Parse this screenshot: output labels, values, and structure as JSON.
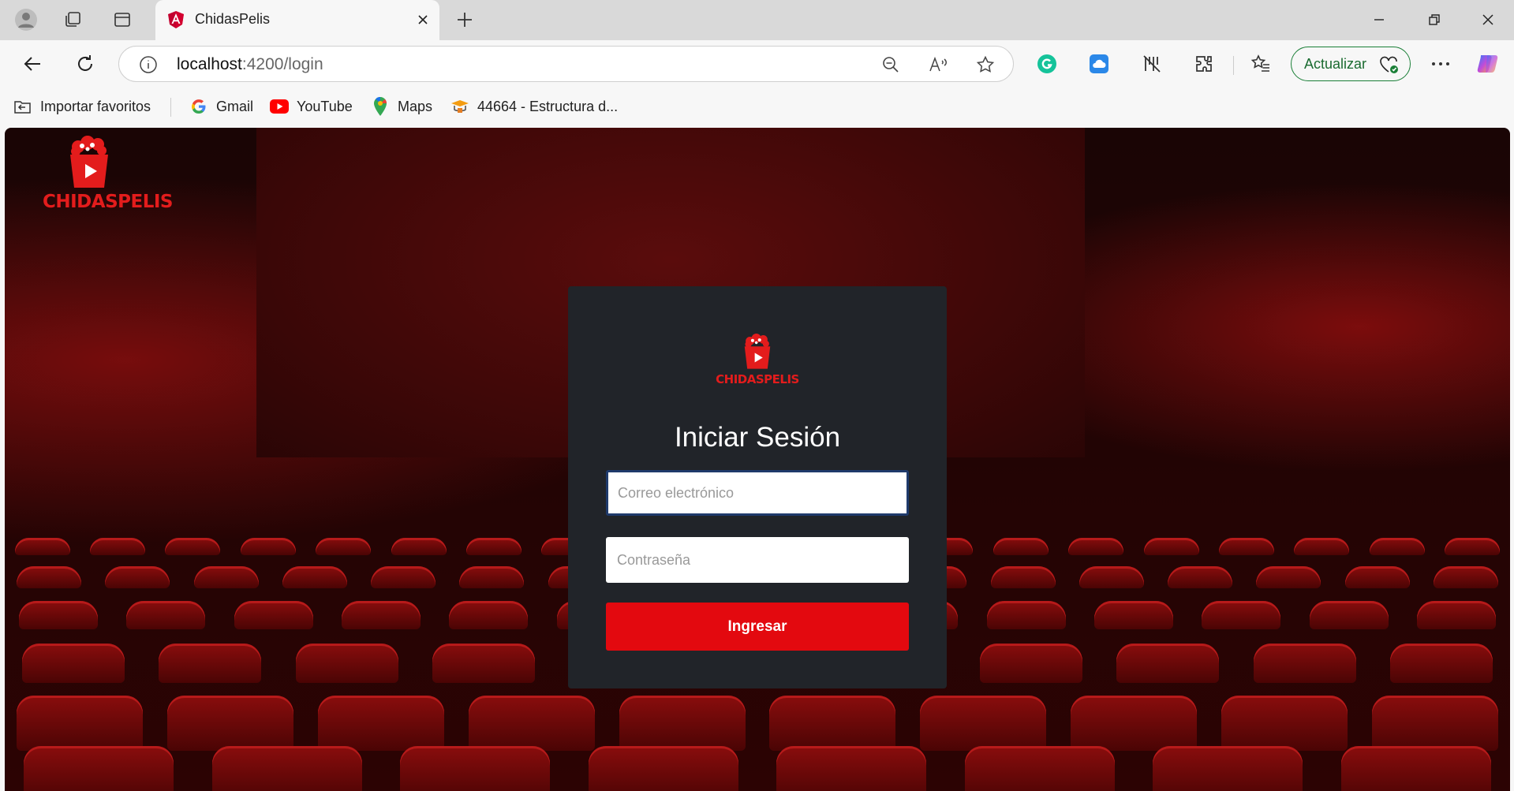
{
  "browser": {
    "tab": {
      "title": "ChidasPelis"
    },
    "address": {
      "host": "localhost",
      "path": ":4200/login"
    },
    "update_label": "Actualizar",
    "bookmarks": [
      {
        "label": "Importar favoritos",
        "icon": "import-icon"
      },
      {
        "label": "Gmail",
        "icon": "google-icon"
      },
      {
        "label": "YouTube",
        "icon": "youtube-icon"
      },
      {
        "label": "Maps",
        "icon": "maps-icon"
      },
      {
        "label": "44664 - Estructura d...",
        "icon": "course-icon"
      }
    ]
  },
  "page": {
    "brand": "CHIDASPELIS",
    "login": {
      "title": "Iniciar Sesión",
      "email_placeholder": "Correo electrónico",
      "password_placeholder": "Contraseña",
      "submit_label": "Ingresar"
    }
  },
  "colors": {
    "accent": "#e3090f",
    "card": "#212429",
    "brand_red": "#e31c1c"
  }
}
